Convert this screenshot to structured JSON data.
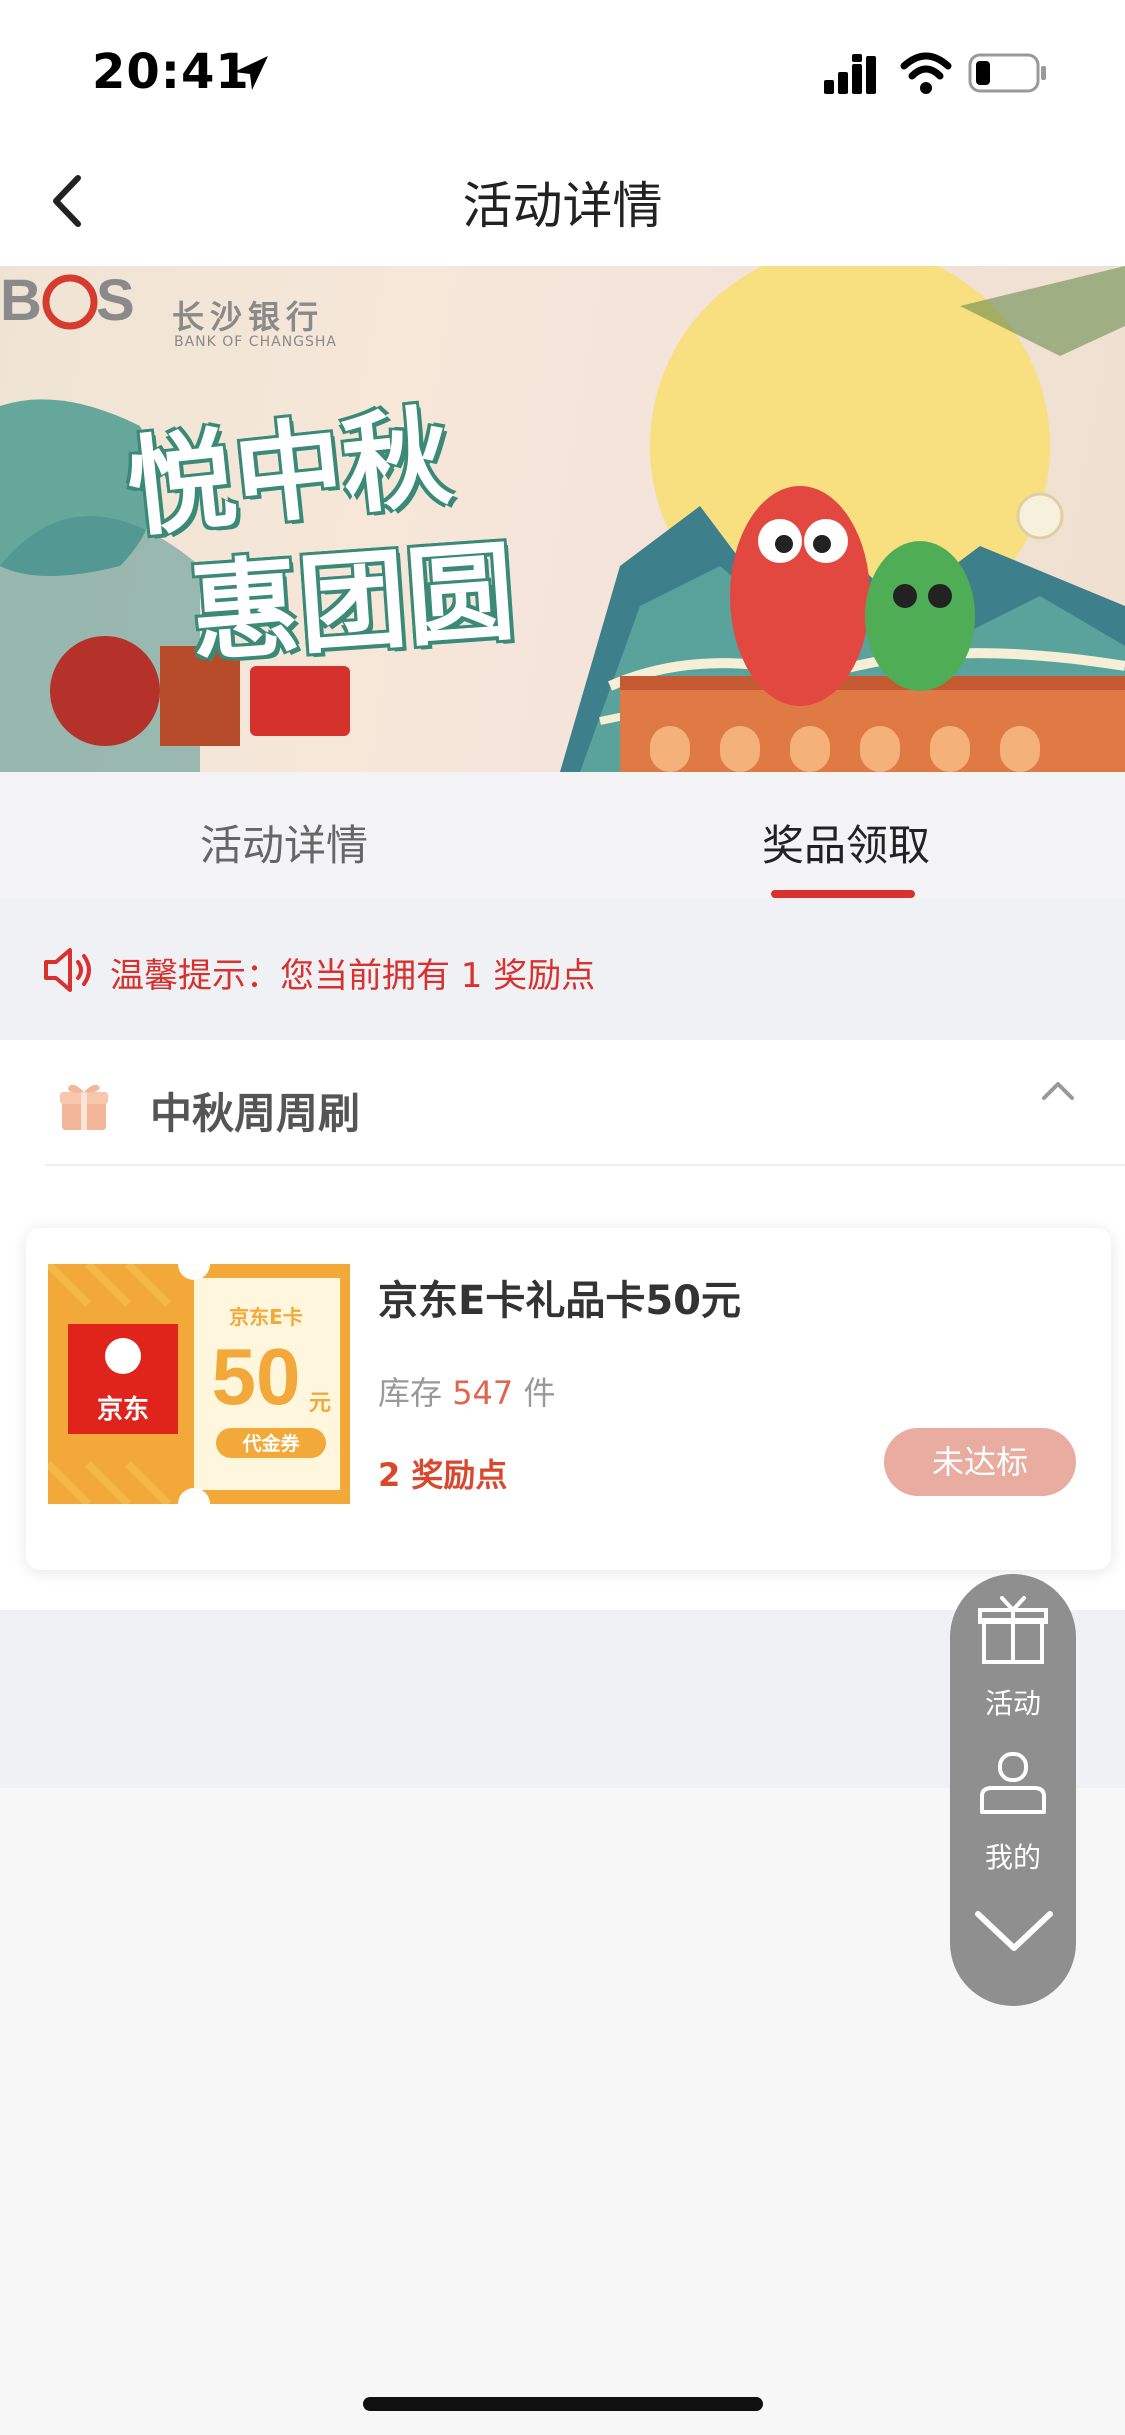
{
  "status_bar": {
    "time": "20:41"
  },
  "nav": {
    "title": "活动详情"
  },
  "banner": {
    "brand_abbr": "BCS",
    "brand_name": "长沙银行",
    "brand_name_en": "BANK OF CHANGSHA",
    "headline_line1": "悦中秋",
    "headline_line2": "惠团圆"
  },
  "tabs": [
    {
      "label": "活动详情",
      "active": false
    },
    {
      "label": "奖品领取",
      "active": true
    }
  ],
  "tip": {
    "text": "温馨提示：您当前拥有 1 奖励点"
  },
  "section": {
    "title": "中秋周周刷",
    "products": [
      {
        "name": "京东E卡礼品卡50元",
        "stock_prefix": "库存",
        "stock_count": "547",
        "stock_unit": "件",
        "points": "2 奖励点",
        "status": "未达标",
        "coupon": {
          "brand": "京东",
          "card_label": "京东E卡",
          "amount": "50",
          "unit": "元",
          "tag": "代金券"
        }
      }
    ]
  },
  "float_menu": {
    "item1": "活动",
    "item2": "我的"
  },
  "colors": {
    "accent": "#d9312d",
    "disabled_button": "#e9aca0",
    "coupon_orange": "#f3a93a"
  }
}
